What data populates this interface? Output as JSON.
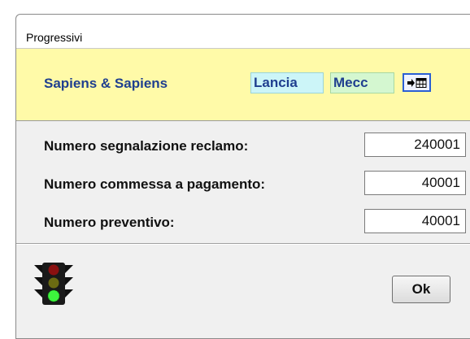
{
  "window": {
    "title": "Progressivi"
  },
  "banner": {
    "company": "Sapiens & Sapiens",
    "chip_lancia": "Lancia",
    "chip_mecc": "Mecc",
    "icon_button": "arrow-grid-icon"
  },
  "fields": [
    {
      "label": "Numero segnalazione reclamo:",
      "value": "240001"
    },
    {
      "label": "Numero commessa a pagamento:",
      "value": "40001"
    },
    {
      "label": "Numero preventivo:",
      "value": "40001"
    }
  ],
  "footer": {
    "status_icon": "traffic-light-icon",
    "ok_label": "Ok"
  },
  "colors": {
    "banner_bg": "#fffaa8",
    "company_text": "#1f3f8f",
    "lancia_bg": "#ccf5f8",
    "mecc_bg": "#d4f7d0",
    "window_bg": "#f0f0f0"
  }
}
